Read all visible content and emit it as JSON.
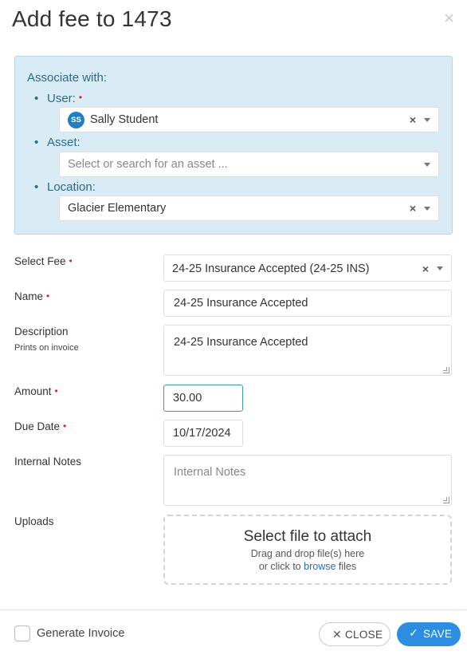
{
  "dialog": {
    "title": "Add fee to 1473",
    "close_glyph": "×"
  },
  "associate": {
    "heading": "Associate with:",
    "user": {
      "label": "User:",
      "avatar_initials": "SS",
      "value": "Sally Student"
    },
    "asset": {
      "label": "Asset:",
      "placeholder": "Select or search for an asset ..."
    },
    "location": {
      "label": "Location:",
      "value": "Glacier Elementary"
    }
  },
  "form": {
    "select_fee": {
      "label": "Select Fee",
      "value": "24-25 Insurance Accepted (24-25 INS)"
    },
    "name": {
      "label": "Name",
      "value": "24-25 Insurance Accepted"
    },
    "description": {
      "label": "Description",
      "sublabel": "Prints on invoice",
      "value": "24-25 Insurance Accepted"
    },
    "amount": {
      "label": "Amount",
      "value": "30.00"
    },
    "due_date": {
      "label": "Due Date",
      "value": "10/17/2024"
    },
    "internal_notes": {
      "label": "Internal Notes",
      "placeholder": "Internal Notes"
    },
    "uploads": {
      "label": "Uploads",
      "title": "Select file to attach",
      "line1": "Drag and drop file(s) here",
      "line2_prefix": "or click to",
      "link": "browse",
      "line2_suffix": "files"
    }
  },
  "footer": {
    "generate_invoice_label": "Generate Invoice",
    "close_label": "CLOSE",
    "save_label": "SAVE"
  },
  "symbols": {
    "required": "•",
    "clear": "×",
    "bullet": "•",
    "close_x": "✕",
    "check": "✓"
  },
  "colors": {
    "accent": "#2b8ee0",
    "assoc_bg": "#d9ecf6",
    "assoc_text": "#2a6a8c",
    "required": "#e02020",
    "avatar": "#1f7fc4",
    "link": "#1f6fb2"
  }
}
